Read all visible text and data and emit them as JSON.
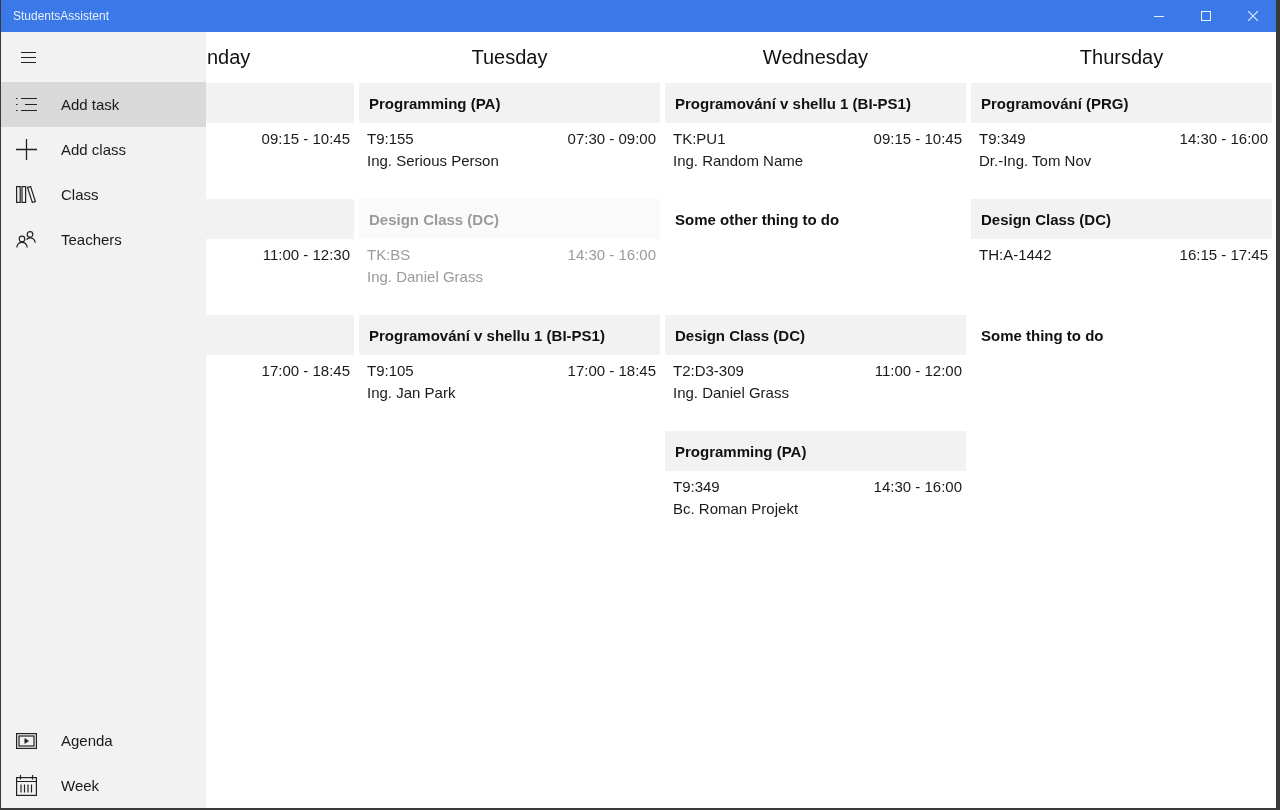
{
  "window": {
    "title": "StudentsAssistent"
  },
  "nav_pane": {
    "items": [
      {
        "label": "Add task",
        "selected": true
      },
      {
        "label": "Add class",
        "selected": false
      },
      {
        "label": "Class",
        "selected": false
      },
      {
        "label": "Teachers",
        "selected": false
      }
    ],
    "footer_items": [
      {
        "label": "Agenda",
        "selected": false
      },
      {
        "label": "Week",
        "selected": false
      }
    ]
  },
  "week": {
    "days": [
      {
        "name": "nday",
        "entries": [
          {
            "kind": "class",
            "time": "09:15 - 10:45",
            "disabled": false
          },
          {
            "kind": "class",
            "time": "11:00 - 12:30",
            "disabled": false
          },
          {
            "kind": "class",
            "time": "17:00 - 18:45",
            "disabled": false
          }
        ]
      },
      {
        "name": "Tuesday",
        "entries": [
          {
            "kind": "class",
            "title": "Programming (PA)",
            "location": "T9:155",
            "time": "07:30 - 09:00",
            "teacher": "Ing. Serious Person",
            "disabled": false
          },
          {
            "kind": "class",
            "title": "Design Class (DC)",
            "location": "TK:BS",
            "time": "14:30 - 16:00",
            "teacher": "Ing. Daniel Grass",
            "disabled": true
          },
          {
            "kind": "class",
            "title": "Programování v shellu 1 (BI-PS1)",
            "location": "T9:105",
            "time": "17:00 - 18:45",
            "teacher": "Ing. Jan Park",
            "disabled": false
          }
        ]
      },
      {
        "name": "Wednesday",
        "entries": [
          {
            "kind": "class",
            "title": "Programování v shellu 1 (BI-PS1)",
            "location": "TK:PU1",
            "time": "09:15 - 10:45",
            "teacher": "Ing. Random Name",
            "disabled": false
          },
          {
            "kind": "task",
            "title": "Some other thing to do",
            "disabled": false
          },
          {
            "kind": "class",
            "title": "Design Class (DC)",
            "location": "T2:D3-309",
            "time": "11:00 - 12:00",
            "teacher": "Ing. Daniel Grass",
            "disabled": false
          },
          {
            "kind": "class",
            "title": "Programming (PA)",
            "location": "T9:349",
            "time": "14:30 - 16:00",
            "teacher": "Bc. Roman Projekt",
            "disabled": false
          }
        ]
      },
      {
        "name": "Thursday",
        "entries": [
          {
            "kind": "class",
            "title": "Programování (PRG)",
            "location": "T9:349",
            "time": "14:30 - 16:00",
            "teacher": "Dr.-Ing. Tom Nov",
            "disabled": false
          },
          {
            "kind": "class",
            "title": "Design Class (DC)",
            "location": "TH:A-1442",
            "time": "16:15 - 17:45",
            "disabled": false
          },
          {
            "kind": "task",
            "title": "Some thing to do",
            "disabled": false
          }
        ]
      }
    ]
  }
}
